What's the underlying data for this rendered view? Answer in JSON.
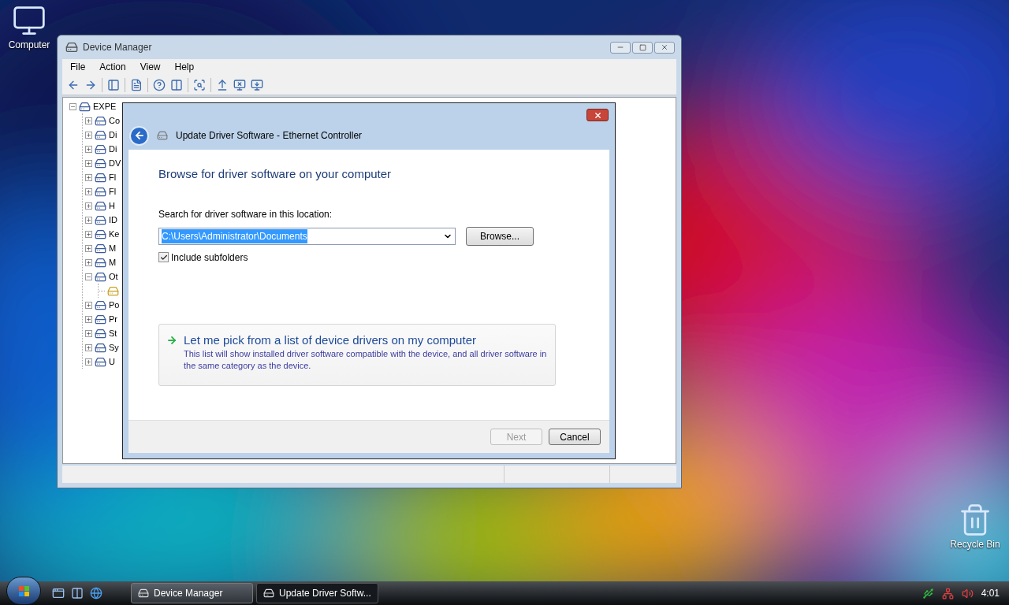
{
  "desktop_icons": [
    {
      "label": "Computer",
      "kind": "computer"
    },
    {
      "label": "Recycle Bin",
      "kind": "bin"
    }
  ],
  "device_manager": {
    "title": "Device Manager",
    "menu": [
      "File",
      "Action",
      "View",
      "Help"
    ],
    "tree": {
      "label": "EXPE",
      "kind": "category",
      "expanded": true,
      "children": [
        {
          "label": "Co",
          "kind": "category",
          "expanded": false
        },
        {
          "label": "Di",
          "kind": "category",
          "expanded": false
        },
        {
          "label": "Di",
          "kind": "category",
          "expanded": false
        },
        {
          "label": "DV",
          "kind": "category",
          "expanded": false
        },
        {
          "label": "Fl",
          "kind": "category",
          "expanded": false
        },
        {
          "label": "Fl",
          "kind": "category",
          "expanded": false
        },
        {
          "label": "H",
          "kind": "category",
          "expanded": false
        },
        {
          "label": "ID",
          "kind": "category",
          "expanded": false
        },
        {
          "label": "Ke",
          "kind": "category",
          "expanded": false
        },
        {
          "label": "M",
          "kind": "category",
          "expanded": false
        },
        {
          "label": "M",
          "kind": "category",
          "expanded": false
        },
        {
          "label": "Ot",
          "kind": "category",
          "expanded": true,
          "children": [
            {
              "kind": "device"
            }
          ]
        },
        {
          "label": "Po",
          "kind": "category",
          "expanded": false
        },
        {
          "label": "Pr",
          "kind": "category",
          "expanded": false
        },
        {
          "label": "St",
          "kind": "category",
          "expanded": false
        },
        {
          "label": "Sy",
          "kind": "category",
          "expanded": false
        },
        {
          "label": "U",
          "kind": "category",
          "expanded": false
        }
      ]
    }
  },
  "dialog": {
    "title": "Update Driver Software - Ethernet Controller",
    "heading": "Browse for driver software on your computer",
    "location_label": "Search for driver software in this location:",
    "location_value": "C:\\Users\\Administrator\\Documents",
    "value_selected": true,
    "browse_button": "Browse...",
    "include_subfolders": {
      "label": "Include subfolders",
      "checked": true
    },
    "option": {
      "title": "Let me pick from a list of device drivers on my computer",
      "description": "This list will show installed driver software compatible with the device, and all driver software in the same category as the device."
    },
    "buttons": [
      {
        "label": "Next",
        "disabled": true
      },
      {
        "label": "Cancel",
        "disabled": false
      }
    ]
  },
  "taskbar": {
    "tasks": [
      {
        "label": "Device Manager",
        "selected": false
      },
      {
        "label": "Update Driver Softw...",
        "selected": true
      }
    ],
    "clock": "4:01"
  }
}
